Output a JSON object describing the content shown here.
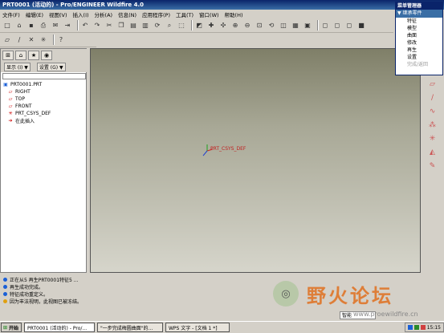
{
  "window": {
    "title": "PRT0001 (活动的) - Pro/ENGINEER Wildfire 4.0"
  },
  "menubar": {
    "items": [
      "文件(F)",
      "编辑(E)",
      "视图(V)",
      "插入(I)",
      "分析(A)",
      "信息(N)",
      "应用程序(P)",
      "工具(T)",
      "窗口(W)",
      "帮助(H)"
    ]
  },
  "menu_manager": {
    "title": "菜单管理器",
    "submenu": "▼ 继承零件",
    "items": [
      "特征",
      "模型",
      "曲面",
      "修改",
      "再生",
      "设置"
    ],
    "disabled_item": "完成/返回"
  },
  "left_panel": {
    "show_label": "显示 (I) ▼",
    "settings_label": "设置 (G) ▼",
    "tree": [
      {
        "label": "PRT0001.PRT",
        "icon": "part-icon"
      },
      {
        "label": "RIGHT",
        "icon": "datum-plane-icon"
      },
      {
        "label": "TOP",
        "icon": "datum-plane-icon"
      },
      {
        "label": "FRONT",
        "icon": "datum-plane-icon"
      },
      {
        "label": "PRT_CSYS_DEF",
        "icon": "csys-icon"
      },
      {
        "label": "在此插入",
        "icon": "insert-here-icon"
      }
    ]
  },
  "canvas": {
    "csys_label": "PRT_CSYS_DEF"
  },
  "messages": [
    "正在从5 再生PRT0001特征5 ...",
    "再生成功完成。",
    "特征成功重定义。",
    "因为丰法视明，此视图已被冻结。"
  ],
  "filter": {
    "value": "智能"
  },
  "watermark": {
    "text": "野火论坛",
    "url": "www.proewildfire.cn"
  },
  "taskbar": {
    "start": "开始",
    "tasks": [
      "PRT0001 (活动的) - Pro/...",
      "\"一步完成梅圆曲面\"的...",
      "WPS 文字 - [文档 1 *]"
    ],
    "clock": "15:15"
  }
}
